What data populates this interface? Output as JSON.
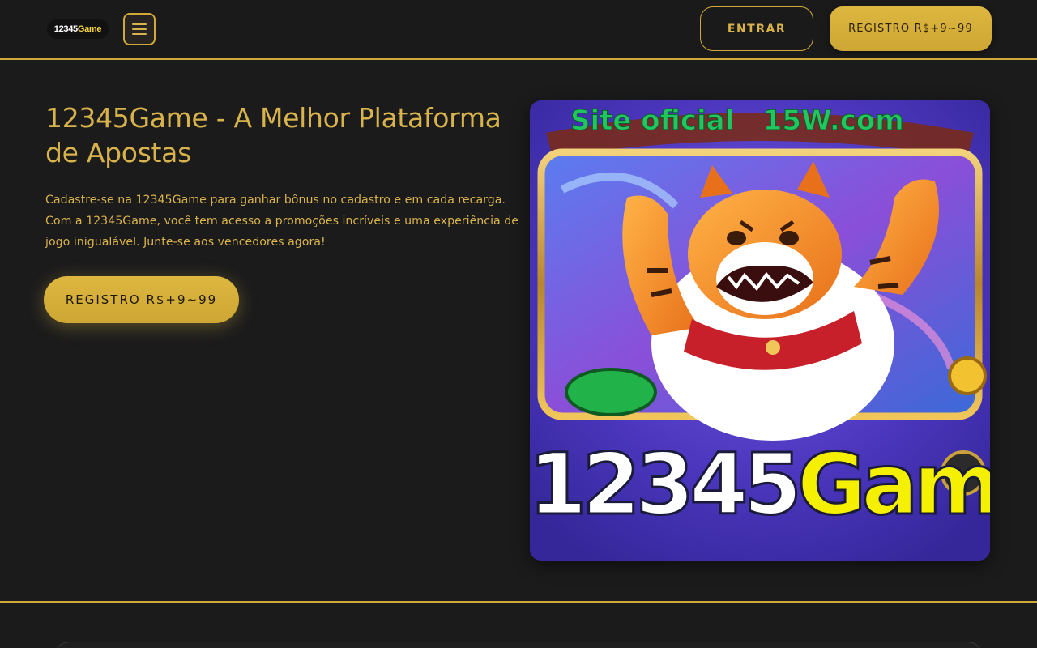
{
  "header": {
    "logo_text_white": "12345",
    "logo_text_yellow": "Game",
    "menu_icon": "hamburger-menu-icon",
    "login_label": "ENTRAR",
    "register_label": "REGISTRO R$+9~99"
  },
  "hero": {
    "title": "12345Game - A Melhor Plataforma de Apostas",
    "description": "Cadastre-se na 12345Game para ganhar bônus no cadastro e em cada recarga. Com a 12345Game, você tem acesso a promoções incríveis e uma experiência de jogo inigualável. Junte-se aos vencedores agora!",
    "register_label": "REGISTRO R$+9~99"
  },
  "promo_image": {
    "top_text": "Site oficial   15W.com",
    "brand_white": "12345",
    "brand_yellow": "Game",
    "illustration": "tiger-mascot-illustration"
  },
  "colors": {
    "background": "#1b1b1c",
    "accent_gold": "#d1a93a",
    "text_gold": "#d8b24a",
    "promo_purple": "#4a34b8",
    "promo_green": "#22c55e",
    "brand_yellow": "#f5f000"
  }
}
